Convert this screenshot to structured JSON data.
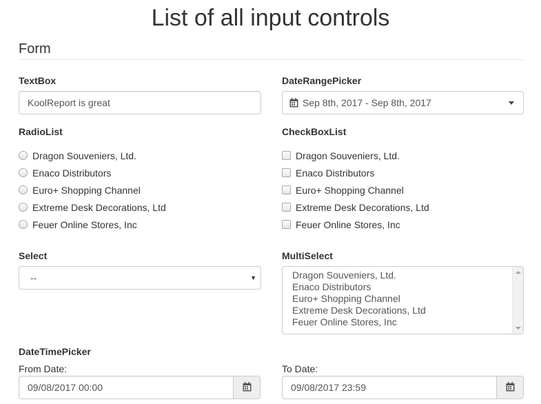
{
  "page": {
    "title": "List of all input controls"
  },
  "form": {
    "heading": "Form"
  },
  "textbox": {
    "label": "TextBox",
    "value": "KoolReport is great"
  },
  "daterange": {
    "label": "DateRangePicker",
    "value": "Sep 8th, 2017 - Sep 8th, 2017",
    "icon": "calendar-icon"
  },
  "radiolist": {
    "label": "RadioList",
    "options": [
      "Dragon Souveniers, Ltd.",
      "Enaco Distributors",
      "Euro+ Shopping Channel",
      "Extreme Desk Decorations, Ltd",
      "Feuer Online Stores, Inc"
    ]
  },
  "checkboxlist": {
    "label": "CheckBoxList",
    "options": [
      "Dragon Souveniers, Ltd.",
      "Enaco Distributors",
      "Euro+ Shopping Channel",
      "Extreme Desk Decorations, Ltd",
      "Feuer Online Stores, Inc"
    ]
  },
  "select": {
    "label": "Select",
    "value": "--"
  },
  "multiselect": {
    "label": "MultiSelect",
    "options": [
      "Dragon Souveniers, Ltd.",
      "Enaco Distributors",
      "Euro+ Shopping Channel",
      "Extreme Desk Decorations, Ltd",
      "Feuer Online Stores, Inc"
    ]
  },
  "datetimepicker": {
    "label": "DateTimePicker",
    "from": {
      "label": "From Date:",
      "value": "09/08/2017 00:00"
    },
    "to": {
      "label": "To Date:",
      "value": "09/08/2017 23:59"
    }
  },
  "colors": {
    "border": "#cccccc",
    "addon_bg": "#eeeeee",
    "text": "#333333"
  }
}
